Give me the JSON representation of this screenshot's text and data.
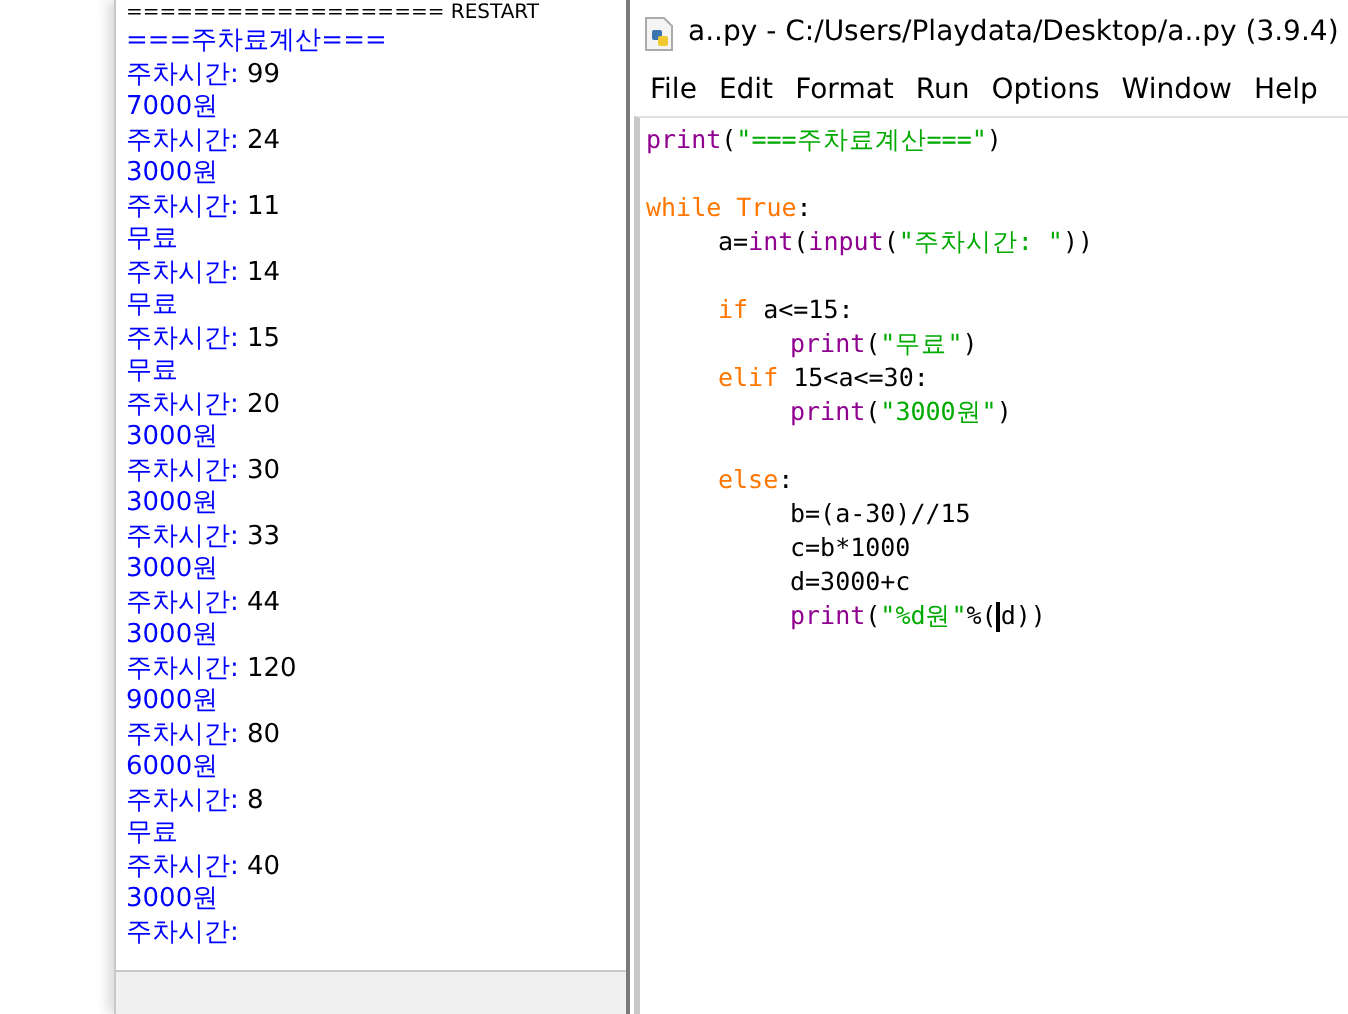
{
  "shell": {
    "restart_line": "=================== RESTART",
    "lines": [
      {
        "kind": "output",
        "text": "===주차료계산==="
      },
      {
        "kind": "prompt",
        "text": "주차시간: ",
        "input": "99"
      },
      {
        "kind": "output",
        "text": "7000원"
      },
      {
        "kind": "prompt",
        "text": "주차시간: ",
        "input": "24"
      },
      {
        "kind": "output",
        "text": "3000원"
      },
      {
        "kind": "prompt",
        "text": "주차시간: ",
        "input": "11"
      },
      {
        "kind": "output",
        "text": "무료"
      },
      {
        "kind": "prompt",
        "text": "주차시간: ",
        "input": "14"
      },
      {
        "kind": "output",
        "text": "무료"
      },
      {
        "kind": "prompt",
        "text": "주차시간: ",
        "input": "15"
      },
      {
        "kind": "output",
        "text": "무료"
      },
      {
        "kind": "prompt",
        "text": "주차시간: ",
        "input": "20"
      },
      {
        "kind": "output",
        "text": "3000원"
      },
      {
        "kind": "prompt",
        "text": "주차시간: ",
        "input": "30"
      },
      {
        "kind": "output",
        "text": "3000원"
      },
      {
        "kind": "prompt",
        "text": "주차시간: ",
        "input": "33"
      },
      {
        "kind": "output",
        "text": "3000원"
      },
      {
        "kind": "prompt",
        "text": "주차시간: ",
        "input": "44"
      },
      {
        "kind": "output",
        "text": "3000원"
      },
      {
        "kind": "prompt",
        "text": "주차시간: ",
        "input": "120"
      },
      {
        "kind": "output",
        "text": "9000원"
      },
      {
        "kind": "prompt",
        "text": "주차시간: ",
        "input": "80"
      },
      {
        "kind": "output",
        "text": "6000원"
      },
      {
        "kind": "prompt",
        "text": "주차시간: ",
        "input": "8"
      },
      {
        "kind": "output",
        "text": "무료"
      },
      {
        "kind": "prompt",
        "text": "주차시간: ",
        "input": "40"
      },
      {
        "kind": "output",
        "text": "3000원"
      },
      {
        "kind": "prompt",
        "text": "주차시간:"
      }
    ]
  },
  "editor": {
    "window": {
      "title": "a..py - C:/Users/Playdata/Desktop/a..py (3.9.4)"
    },
    "menu": [
      "File",
      "Edit",
      "Format",
      "Run",
      "Options",
      "Window",
      "Help"
    ],
    "code": [
      [
        {
          "kind": "builtin",
          "text": "print"
        },
        {
          "kind": "plain",
          "text": "("
        },
        {
          "kind": "string",
          "text": "\"===주차료계산===\""
        },
        {
          "kind": "plain",
          "text": ")"
        }
      ],
      {
        "kind": "blank"
      },
      [
        {
          "kind": "keyword",
          "text": "while True"
        },
        {
          "kind": "plain",
          "text": ":"
        }
      ],
      [
        {
          "kind": "indent"
        },
        {
          "kind": "plain",
          "text": "a="
        },
        {
          "kind": "builtin",
          "text": "int"
        },
        {
          "kind": "plain",
          "text": "("
        },
        {
          "kind": "builtin",
          "text": "input"
        },
        {
          "kind": "plain",
          "text": "("
        },
        {
          "kind": "string",
          "text": "\"주차시간: \""
        },
        {
          "kind": "plain",
          "text": "))"
        }
      ],
      {
        "kind": "blank"
      },
      [
        {
          "kind": "indent"
        },
        {
          "kind": "keyword",
          "text": "if"
        },
        {
          "kind": "plain",
          "text": " a<=15:"
        }
      ],
      [
        {
          "kind": "indent"
        },
        {
          "kind": "indent"
        },
        {
          "kind": "builtin",
          "text": "print"
        },
        {
          "kind": "plain",
          "text": "("
        },
        {
          "kind": "string",
          "text": "\"무료\""
        },
        {
          "kind": "plain",
          "text": ")"
        }
      ],
      [
        {
          "kind": "indent"
        },
        {
          "kind": "keyword",
          "text": "elif"
        },
        {
          "kind": "plain",
          "text": " 15<a<=30:"
        }
      ],
      [
        {
          "kind": "indent"
        },
        {
          "kind": "indent"
        },
        {
          "kind": "builtin",
          "text": "print"
        },
        {
          "kind": "plain",
          "text": "("
        },
        {
          "kind": "string",
          "text": "\"3000원\""
        },
        {
          "kind": "plain",
          "text": ")"
        }
      ],
      {
        "kind": "blank"
      },
      [
        {
          "kind": "indent"
        },
        {
          "kind": "keyword",
          "text": "else"
        },
        {
          "kind": "plain",
          "text": ":"
        }
      ],
      [
        {
          "kind": "indent"
        },
        {
          "kind": "indent"
        },
        {
          "kind": "plain",
          "text": "b=(a-30)//15"
        }
      ],
      [
        {
          "kind": "indent"
        },
        {
          "kind": "indent"
        },
        {
          "kind": "plain",
          "text": "c=b*1000"
        }
      ],
      [
        {
          "kind": "indent"
        },
        {
          "kind": "indent"
        },
        {
          "kind": "plain",
          "text": "d=3000+c"
        }
      ],
      [
        {
          "kind": "indent"
        },
        {
          "kind": "indent"
        },
        {
          "kind": "builtin",
          "text": "print"
        },
        {
          "kind": "plain",
          "text": "("
        },
        {
          "kind": "string",
          "text": "\"%d원\""
        },
        {
          "kind": "plain",
          "text": "%("
        },
        {
          "kind": "cursor"
        },
        {
          "kind": "plain",
          "text": "d))"
        }
      ]
    ]
  }
}
